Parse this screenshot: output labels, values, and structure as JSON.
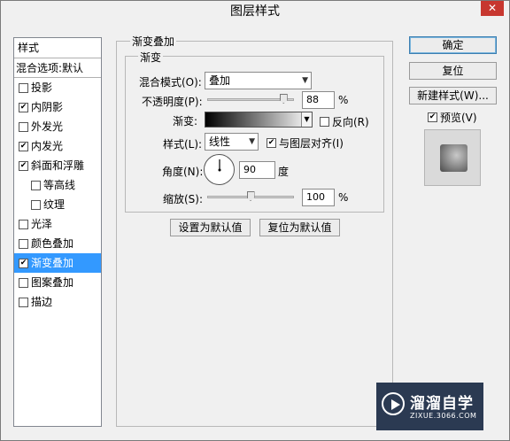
{
  "window": {
    "title": "图层样式",
    "close_glyph": "✕"
  },
  "styles_panel": {
    "header": "样式",
    "blend_options": "混合选项:默认",
    "items": [
      {
        "label": "投影",
        "checked": false,
        "indent": false,
        "selected": false
      },
      {
        "label": "内阴影",
        "checked": true,
        "indent": false,
        "selected": false
      },
      {
        "label": "外发光",
        "checked": false,
        "indent": false,
        "selected": false
      },
      {
        "label": "内发光",
        "checked": true,
        "indent": false,
        "selected": false
      },
      {
        "label": "斜面和浮雕",
        "checked": true,
        "indent": false,
        "selected": false
      },
      {
        "label": "等高线",
        "checked": false,
        "indent": true,
        "selected": false
      },
      {
        "label": "纹理",
        "checked": false,
        "indent": true,
        "selected": false
      },
      {
        "label": "光泽",
        "checked": false,
        "indent": false,
        "selected": false
      },
      {
        "label": "颜色叠加",
        "checked": false,
        "indent": false,
        "selected": false
      },
      {
        "label": "渐变叠加",
        "checked": true,
        "indent": false,
        "selected": true
      },
      {
        "label": "图案叠加",
        "checked": false,
        "indent": false,
        "selected": false
      },
      {
        "label": "描边",
        "checked": false,
        "indent": false,
        "selected": false
      }
    ]
  },
  "gradient_overlay": {
    "group_title": "渐变叠加",
    "sub_title": "渐变",
    "blend_mode": {
      "label": "混合模式(O):",
      "value": "叠加"
    },
    "opacity": {
      "label": "不透明度(P):",
      "value": "88",
      "unit": "%",
      "level": 0.88
    },
    "gradient": {
      "label": "渐变:",
      "reverse_label": "反向(R)",
      "reverse_checked": false,
      "colors": [
        "#000000",
        "#ffffff"
      ]
    },
    "style": {
      "label": "样式(L):",
      "value": "线性",
      "align_label": "与图层对齐(I)",
      "align_checked": true
    },
    "angle": {
      "label": "角度(N):",
      "value": "90",
      "unit": "度",
      "degrees": 90
    },
    "scale": {
      "label": "缩放(S):",
      "value": "100",
      "unit": "%",
      "level": 0.5
    },
    "set_default_button": "设置为默认值",
    "reset_default_button": "复位为默认值"
  },
  "actions": {
    "ok": "确定",
    "reset": "复位",
    "new_style": "新建样式(W)...",
    "preview_label": "预览(V)",
    "preview_checked": true
  },
  "watermark": {
    "title": "溜溜自学",
    "subtitle": "ZIXUE.3066.COM"
  },
  "colors": {
    "selection": "#3399ff",
    "dialog_bg": "#f0f0f0",
    "watermark_bg": "#2b3a52"
  }
}
